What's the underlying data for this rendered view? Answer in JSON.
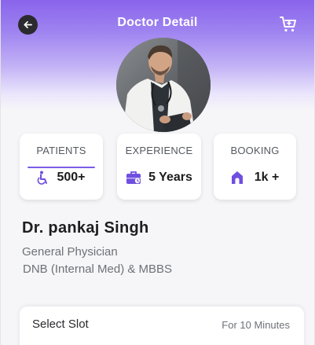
{
  "header": {
    "title": "Doctor Detail",
    "back_icon": "arrow-left-icon",
    "cart_icon": "cart-icon"
  },
  "doctor": {
    "avatar": "doctor-photo",
    "name": "Dr. pankaj Singh",
    "specialty": "General Physician",
    "degree": "DNB (Internal Med) & MBBS"
  },
  "stats": [
    {
      "label": "PATIENTS",
      "value": "500+",
      "icon": "wheelchair-icon",
      "active": true
    },
    {
      "label": "EXPERIENCE",
      "value": "5 Years",
      "icon": "briefcase-icon",
      "active": false
    },
    {
      "label": "BOOKING",
      "value": "1k +",
      "icon": "home-icon",
      "active": false
    }
  ],
  "slot": {
    "title": "Select Slot",
    "duration": "For 10 Minutes"
  },
  "colors": {
    "accent": "#7b5ce8",
    "header_top": "#8a64ec",
    "icon_accent": "#6f4fe0"
  }
}
